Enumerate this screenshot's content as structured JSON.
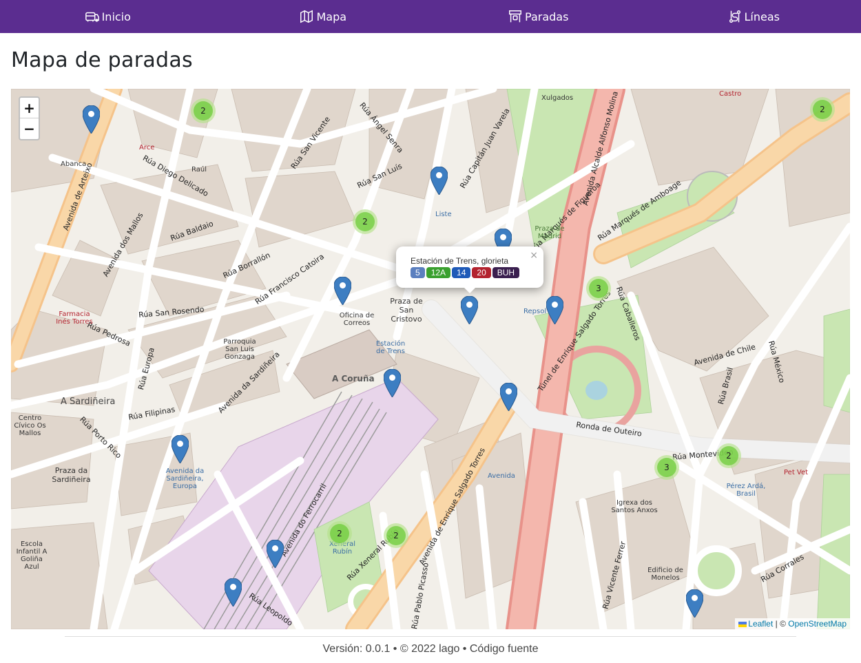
{
  "nav": {
    "items": [
      {
        "label": "Inicio",
        "icon": "bus-home-icon"
      },
      {
        "label": "Mapa",
        "icon": "map-icon"
      },
      {
        "label": "Paradas",
        "icon": "bus-stop-icon"
      },
      {
        "label": "Líneas",
        "icon": "route-icon"
      }
    ],
    "color": "#5b2d90"
  },
  "page": {
    "title": "Mapa de paradas"
  },
  "map": {
    "zoom_in": "+",
    "zoom_out": "−",
    "popup": {
      "stop_name": "Estación de Trens, glorieta",
      "close": "×",
      "lines": [
        {
          "label": "5",
          "color": "#5b7fbf"
        },
        {
          "label": "12A",
          "color": "#3aa02f"
        },
        {
          "label": "14",
          "color": "#1f5ab8"
        },
        {
          "label": "20",
          "color": "#b3232f"
        },
        {
          "label": "BUH",
          "color": "#3a1f4f"
        }
      ]
    },
    "clusters": [
      {
        "count": "2"
      },
      {
        "count": "2"
      },
      {
        "count": "3"
      },
      {
        "count": "2"
      },
      {
        "count": "3"
      },
      {
        "count": "2"
      },
      {
        "count": "2"
      },
      {
        "count": "2"
      }
    ],
    "labels": {
      "rua_san_vicente": "Rúa San Vicente",
      "rua_angel_senra": "Rúa Ángel Senra",
      "rua_san_luis": "Rúa San Luís",
      "rua_capitan": "Rúa Capitán Juan Varela",
      "rua_diego_delicado": "Rúa Diego Delicado",
      "rua_baldaio": "Rúa Baldaio",
      "rua_borrallon": "Rúa Borrallón",
      "rua_francisco_catoira": "Rúa Francisco Catoira",
      "rua_san_rosendo": "Rúa San Rosendo",
      "rua_pedrosa": "Rúa Pedrosa",
      "rua_europa": "Rúa Europa",
      "rua_filipinas": "Rúa Filipinas",
      "rua_porto_rico": "Rúa Porto Rico",
      "avenida_sardineira": "Avenida da Sardiñeira",
      "avenida_arteixo": "Avenida de Arteixo",
      "avenida_mallos": "Avenida dos Mallos",
      "ronda_outeiro": "Ronda de Outeiro",
      "rua_marques_figueroa": "Rúa Marqués de Figueroa",
      "avenida_alfonso": "Avenida Alcalde Alfonso Molina",
      "rua_marques_amboage": "Rúa Marqués de Amboage",
      "rua_caballeros": "Rúa Caballeros",
      "avenida_chile": "Avenida de Chile",
      "rua_mexico": "Rúa México",
      "rua_brasil": "Rúa Brasil",
      "rua_montevideo": "Rúa Montevideo",
      "tunel": "Túnel de Enrique Salgado Torres",
      "avenida_enrique": "Avenida de Enrique Salgado Torres",
      "rua_xeneral_rubin": "Rúa Xeneral Rubín",
      "rua_ferrocarril": "Avenida do Ferrocarril",
      "rua_vicente_ferrer": "Rúa Vicente Ferrer",
      "rua_pablo_picasso": "Rúa Pablo Picasso",
      "rua_leopoldo": "Rúa Leopoldo",
      "rua_corrales": "Rúa Corrales",
      "a_coruna": "A Coruña",
      "praza_san_cristovo": "Praza de San Cristovo",
      "oficina_correos": "Oficina de Correos",
      "estacion_trens": "Estación de Trens",
      "liste": "Liste",
      "parroquia": "Parroquia San Luis Gonzaga",
      "a_sardineira": "A Sardiñeira",
      "praza_sardineira": "Praza da Sardiñeira",
      "centro_civico": "Centro Cívico Os Mallos",
      "avenida_sardineira_europa": "Avenida da Sardiñeira, Europa",
      "iglesia": "Igrexa dos Santos Anxos",
      "edificio_monelos": "Edificio de Monelos",
      "perez_arda": "Pérez Ardá, Brasil",
      "pet_vet": "Pet Vet",
      "escola": "Escola Infantil A Goliña Azul",
      "xeneral_rubin": "Xeneral Rubín",
      "avenida": "Avenida",
      "repsol": "Repsol",
      "farmacia": "Farmacia Inés Torres",
      "praza_madrid": "Praza de Madrid",
      "xulgados": "Xulgados",
      "abanca": "Abanca",
      "arce": "Arce",
      "raul": "Raúl",
      "castro": "Castro"
    },
    "attribution": {
      "leaflet": "Leaflet",
      "sep": " | © ",
      "osm": "OpenStreetMap"
    }
  },
  "footer": {
    "text": "Versión: 0.0.1 • © 2022 lago • Código fuente"
  }
}
